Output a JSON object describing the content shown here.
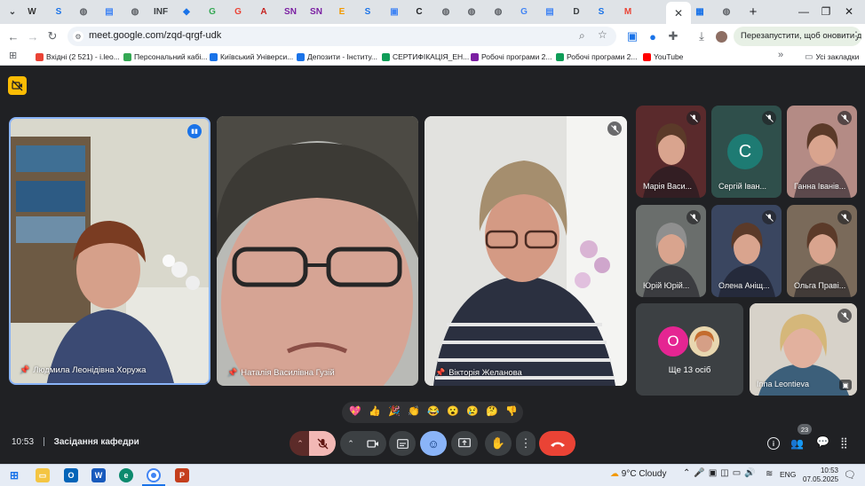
{
  "browser": {
    "tabs": [
      {
        "icon": "chevron-down-icon",
        "glyph": "⌄",
        "color": "#3c4043"
      },
      {
        "icon": "w-icon",
        "glyph": "W",
        "color": "#333333"
      },
      {
        "icon": "s-icon",
        "glyph": "S",
        "color": "#1a73e8"
      },
      {
        "icon": "globe-icon",
        "glyph": "◍",
        "color": "#5f6368"
      },
      {
        "icon": "doc-icon",
        "glyph": "▤",
        "color": "#4285f4"
      },
      {
        "icon": "globe-icon",
        "glyph": "◍",
        "color": "#5f6368"
      },
      {
        "icon": "mail-icon",
        "glyph": "INF",
        "color": "#3c4043"
      },
      {
        "icon": "diamond-icon",
        "glyph": "◆",
        "color": "#1a73e8"
      },
      {
        "icon": "google-icon",
        "glyph": "G",
        "color": "#34a853"
      },
      {
        "icon": "google-icon",
        "glyph": "G",
        "color": "#ea4335"
      },
      {
        "icon": "pdf-icon",
        "glyph": "A",
        "color": "#c5221f"
      },
      {
        "icon": "sn-icon",
        "glyph": "SN",
        "color": "#7b1fa2"
      },
      {
        "icon": "sn-icon",
        "glyph": "SN",
        "color": "#7b1fa2"
      },
      {
        "icon": "e-icon",
        "glyph": "E",
        "color": "#f29900"
      },
      {
        "icon": "s-icon",
        "glyph": "S",
        "color": "#1a73e8"
      },
      {
        "icon": "photo-icon",
        "glyph": "▣",
        "color": "#4285f4"
      },
      {
        "icon": "c-icon",
        "glyph": "C",
        "color": "#202124"
      },
      {
        "icon": "globe-icon",
        "glyph": "◍",
        "color": "#5f6368"
      },
      {
        "icon": "globe-icon",
        "glyph": "◍",
        "color": "#5f6368"
      },
      {
        "icon": "globe-icon",
        "glyph": "◍",
        "color": "#5f6368"
      },
      {
        "icon": "google-icon",
        "glyph": "G",
        "color": "#4285f4"
      },
      {
        "icon": "doc-icon",
        "glyph": "▤",
        "color": "#4285f4"
      },
      {
        "icon": "d-icon",
        "glyph": "D",
        "color": "#3c4043"
      },
      {
        "icon": "s-icon",
        "glyph": "S",
        "color": "#1a73e8"
      },
      {
        "icon": "gmail-icon",
        "glyph": "M",
        "color": "#ea4335"
      },
      {
        "icon": "meet-icon",
        "glyph": "✕",
        "color": "#3c4043"
      },
      {
        "icon": "grid-icon",
        "glyph": "▦",
        "color": "#1a73e8"
      },
      {
        "icon": "globe-icon",
        "glyph": "◍",
        "color": "#5f6368"
      }
    ],
    "new_tab": "+",
    "url": "meet.google.com/zqd-qrgf-udk",
    "restart_label": "Перезапустити, щоб оновити дані",
    "bookmarks": [
      {
        "label": "Вхідні (2 521) - i.leo...",
        "color": "#ea4335"
      },
      {
        "label": "Персональний кабі...",
        "color": "#34a853"
      },
      {
        "label": "Київський Універси...",
        "color": "#1a73e8"
      },
      {
        "label": "Депозити - Інститу...",
        "color": "#1a73e8"
      },
      {
        "label": "СЕРТИФІКАЦІЯ_ЕН...",
        "color": "#0f9d58"
      },
      {
        "label": "Робочі програми 2...",
        "color": "#7b1fa2"
      },
      {
        "label": "Робочі програми 2...",
        "color": "#0f9d58"
      },
      {
        "label": "YouTube",
        "color": "#ff0000"
      }
    ],
    "bookmarks_more": "»",
    "all_bookmarks": "Усі закладки"
  },
  "meet": {
    "participants_main": [
      {
        "name": "Людмила Леонідівна Хоружа",
        "speaking": true
      },
      {
        "name": "Наталія Василівна Гузій",
        "speaking": false
      },
      {
        "name": "Вікторія Желанова",
        "speaking": false
      }
    ],
    "participants_side": [
      {
        "name": "Марія Васи...",
        "kind": "photo",
        "bg": "#5a2a2c"
      },
      {
        "name": "Сергій Іван...",
        "kind": "initial",
        "initial": "С",
        "bg": "#2f4f4b",
        "avatar": "#1e7b73"
      },
      {
        "name": "Ганна Іванів...",
        "kind": "photo",
        "bg": "#b48b85"
      },
      {
        "name": "Юрій Юрій...",
        "kind": "photo",
        "bg": "#6a6e6c"
      },
      {
        "name": "Олена Аніщ...",
        "kind": "photo",
        "bg": "#3a4660"
      },
      {
        "name": "Ольга Праві...",
        "kind": "photo",
        "bg": "#7a6a5a"
      }
    ],
    "others": {
      "initial": "О",
      "label": "Ще 13 осіб"
    },
    "self_tile": {
      "name": "Inna Leontieva"
    },
    "reactions": [
      "💖",
      "👍",
      "🎉",
      "👏",
      "😂",
      "😮",
      "😢",
      "🤔",
      "👎"
    ],
    "time": "10:53",
    "meeting_title": "Засідання кафедри",
    "people_count": "23"
  },
  "taskbar": {
    "weather": "9°C  Cloudy",
    "lang": "ENG",
    "time": "10:53",
    "date": "07.05.2025"
  },
  "colors": {
    "end_call": "#ea4335",
    "mic_muted": "#f2b8b5",
    "active_ctrl": "#8ab4f8",
    "speaking_border": "#8ab4f8",
    "camera_off_badge": "#fbbc04"
  }
}
